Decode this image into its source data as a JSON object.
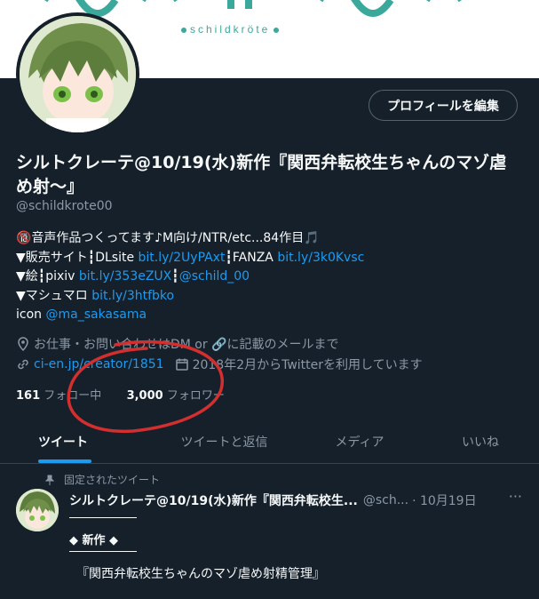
{
  "banner": {
    "subtitle": "schildkröte"
  },
  "profile": {
    "edit_button": "プロフィールを編集",
    "display_name": "シルトクレーテ@10/19(水)新作『関西弁転校生ちゃんのマゾ虐め射〜』",
    "handle": "@schildkrote00",
    "bio": {
      "line1": "🔞音声作品つくってます♪M向け/NTR/etc...84作目🎵",
      "line2_prefix": "▼販売サイト┇DLsite ",
      "line2_link1": "bit.ly/2UyPAxt",
      "line2_mid": "┇FANZA ",
      "line2_link2": "bit.ly/3k0Kvsc",
      "line3_prefix": "▼絵┇pixiv ",
      "line3_link1": "bit.ly/353eZUX",
      "line3_mid": "┇",
      "line3_link2": "@schild_00",
      "line4_prefix": "▼マシュマロ ",
      "line4_link": "bit.ly/3htfbko",
      "line5_prefix": "icon ",
      "line5_link": "@ma_sakasama"
    },
    "location": "お仕事・お問い合わせはDM or 🔗に記載のメールまで",
    "website": "ci-en.jp/creator/1851",
    "joined": "2018年2月からTwitterを利用しています",
    "following_count": "161",
    "following_label": "フォロー中",
    "followers_count": "3,000",
    "followers_label": "フォロワー"
  },
  "tabs": [
    {
      "label": "ツイート"
    },
    {
      "label": "ツイートと返信"
    },
    {
      "label": "メディア"
    },
    {
      "label": "いいね"
    }
  ],
  "tweet": {
    "pinned_label": "固定されたツイート",
    "author": "シルトクレーテ@10/19(水)新作『関西弁転校生...",
    "handle": "@sch...",
    "date": "· 10月19日",
    "more": "···",
    "subtitle": "◆ 新作 ◆",
    "body": "『関西弁転校生ちゃんのマゾ虐め射精管理』"
  },
  "colors": {
    "accent": "#1d9bf0",
    "background": "#15202b",
    "annotation": "#d32f2f"
  }
}
